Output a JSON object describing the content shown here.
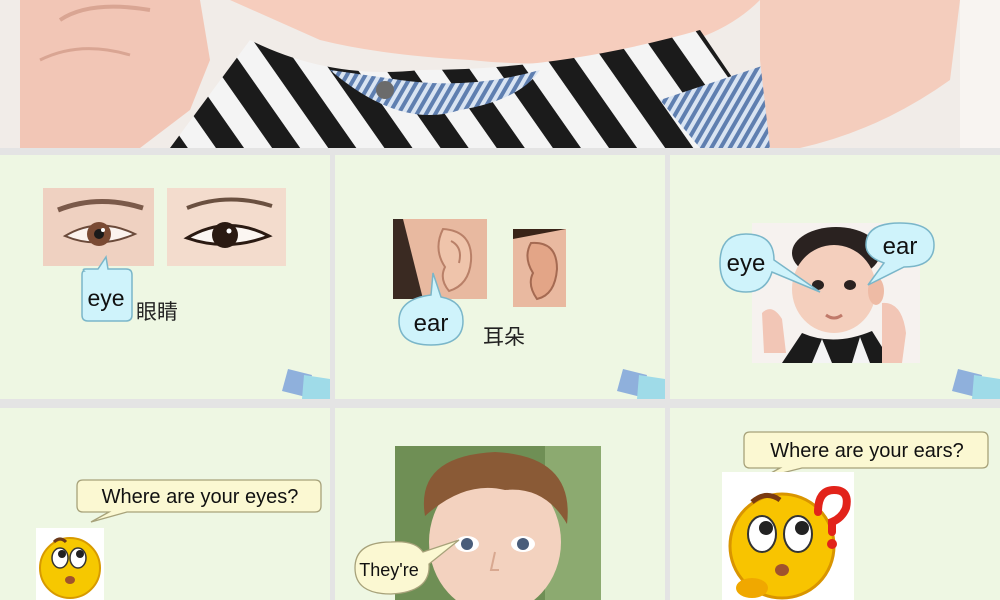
{
  "slides": {
    "s1": {
      "bubble": "eye",
      "chinese": "眼睛"
    },
    "s2": {
      "bubble": "ear",
      "chinese": "耳朵"
    },
    "s3": {
      "bubble_eye": "eye",
      "bubble_ear": "ear"
    },
    "s4": {
      "bubble": "Where are your eyes?"
    },
    "s5": {
      "bubble": "They're"
    },
    "s6": {
      "bubble": "Where are your ears?"
    }
  },
  "icons": [
    "slide-decoration-icon",
    "emoji-thinking-icon",
    "emoji-question-icon"
  ],
  "colors": {
    "slide_bg": "#eef7e3",
    "bubble_blue": "#cff3fb",
    "bubble_cream": "#fbf8d2",
    "separator": "#e4e4e4"
  }
}
